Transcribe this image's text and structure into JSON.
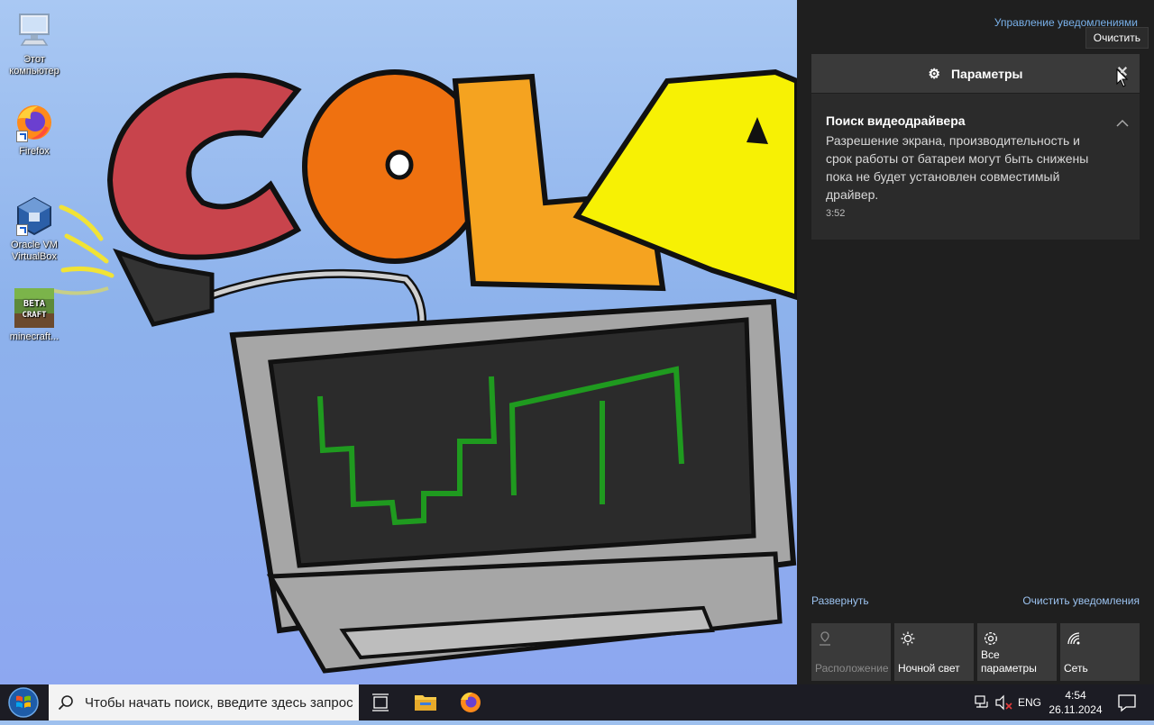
{
  "desktop": {
    "icons": [
      {
        "label": "Этот компьютер",
        "icon": "computer-icon"
      },
      {
        "label": "Firefox",
        "icon": "firefox-icon"
      },
      {
        "label": "Oracle VM VirtualBox",
        "icon": "virtualbox-icon"
      },
      {
        "label": "minecraft...",
        "icon": "minecraft-icon"
      }
    ],
    "wallpaper": {
      "word": "COLA"
    }
  },
  "action_center": {
    "manage_link": "Управление уведомлениями",
    "tooltip": "Очистить",
    "group": {
      "title": "Параметры",
      "icon": "gear-icon"
    },
    "notification": {
      "title": "Поиск видеодрайвера",
      "body": "Разрешение экрана, производительность и срок работы от батареи могут быть снижены пока не будет установлен совместимый драйвер.",
      "time": "3:52"
    },
    "expand_label": "Развернуть",
    "clear_all_label": "Очистить уведомления",
    "tiles": [
      {
        "label": "Расположение",
        "icon": "location-icon",
        "enabled": false
      },
      {
        "label": "Ночной свет",
        "icon": "brightness-icon",
        "enabled": true
      },
      {
        "label": "Все параметры",
        "icon": "gear-icon",
        "enabled": true
      },
      {
        "label": "Сеть",
        "icon": "network-icon",
        "enabled": true
      }
    ]
  },
  "taskbar": {
    "search_placeholder": "Чтобы начать поиск, введите здесь запрос",
    "language": "ENG",
    "time": "4:54",
    "date": "26.11.2024"
  },
  "colors": {
    "action_center_bg": "#1f1f1f",
    "tile_bg": "#3a3a3a",
    "link": "#79b1ea",
    "taskbar_bg": "#1c1c24"
  }
}
